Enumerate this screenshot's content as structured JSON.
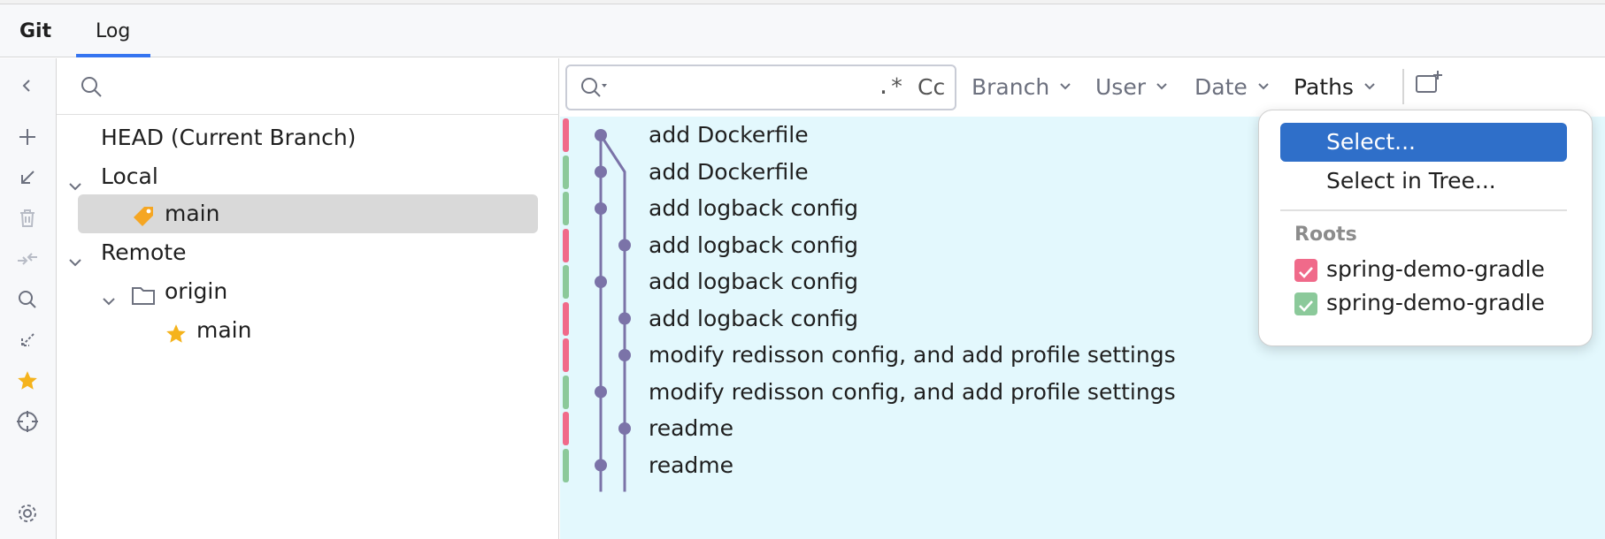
{
  "tabs": {
    "git": "Git",
    "log": "Log"
  },
  "branches": {
    "search_placeholder": "",
    "head": "HEAD (Current Branch)",
    "local": {
      "label": "Local",
      "items": [
        {
          "name": "main",
          "icon": "tag-icon",
          "selected": true
        }
      ]
    },
    "remote": {
      "label": "Remote",
      "origin": {
        "label": "origin",
        "items": [
          {
            "name": "main",
            "icon": "star-icon"
          }
        ]
      }
    }
  },
  "filters": {
    "text_value": "",
    "regex_label": ".*",
    "case_label": "Cc",
    "branch": "Branch",
    "user": "User",
    "date": "Date",
    "paths": "Paths"
  },
  "colors": {
    "root_red": "#f06a8a",
    "root_green": "#8bc99a",
    "graph_node": "#7b73a8",
    "log_background": "#e3f8fd",
    "highlight": "#2f6fc9"
  },
  "commits": [
    {
      "message": "add Dockerfile",
      "root": "red",
      "lane": 0
    },
    {
      "message": "add Dockerfile",
      "root": "green",
      "lane": 0
    },
    {
      "message": "add logback config",
      "root": "green",
      "lane": 0
    },
    {
      "message": "add logback config",
      "root": "red",
      "lane": 1
    },
    {
      "message": "add logback config",
      "root": "green",
      "lane": 0
    },
    {
      "message": "add logback config",
      "root": "red",
      "lane": 1
    },
    {
      "message": "modify redisson config, and add profile settings",
      "root": "red",
      "lane": 1
    },
    {
      "message": "modify redisson config, and add profile settings",
      "root": "green",
      "lane": 0
    },
    {
      "message": "readme",
      "root": "red",
      "lane": 1
    },
    {
      "message": "readme",
      "root": "green",
      "lane": 0
    }
  ],
  "paths_popup": {
    "items": [
      {
        "label": "Select...",
        "highlighted": true
      },
      {
        "label": "Select in Tree...",
        "highlighted": false
      }
    ],
    "roots_label": "Roots",
    "roots": [
      {
        "name": "spring-demo-gradle",
        "color": "#f06a8a",
        "checked": true
      },
      {
        "name": "spring-demo-gradle",
        "color": "#8bc99a",
        "checked": true
      }
    ]
  }
}
